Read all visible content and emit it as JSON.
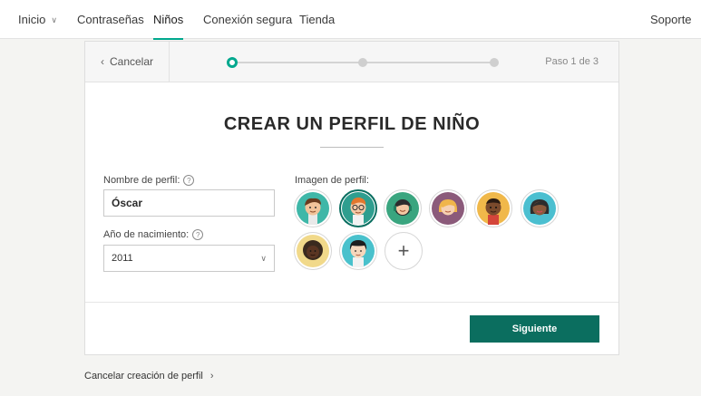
{
  "nav": {
    "items": [
      {
        "label": "Inicio",
        "dropdown": true
      },
      {
        "label": "Contraseñas"
      },
      {
        "label": "Niños",
        "active": true
      },
      {
        "label": "Conexión segura"
      },
      {
        "label": "Tienda"
      }
    ],
    "support": "Soporte"
  },
  "stepper": {
    "cancel": "Cancelar",
    "step_label": "Paso 1 de 3",
    "current_step": 1,
    "total_steps": 3
  },
  "form": {
    "title": "CREAR UN PERFIL DE NIÑO",
    "profile_name_label": "Nombre de perfil:",
    "profile_name_value": "Óscar",
    "birth_year_label": "Año de nacimiento:",
    "birth_year_value": "2011",
    "image_label": "Imagen de perfil:",
    "help_symbol": "?",
    "add_symbol": "+",
    "avatars": [
      {
        "name": "boy-brown-hair",
        "bg": "#3fb7a8",
        "selected": false
      },
      {
        "name": "boy-glasses",
        "bg": "#2f9e8f",
        "selected": true
      },
      {
        "name": "girl-headset",
        "bg": "#3aa57f",
        "selected": false
      },
      {
        "name": "girl-blonde",
        "bg": "#8b5a7a",
        "selected": false
      },
      {
        "name": "boy-dark-skin",
        "bg": "#f0b84a",
        "selected": false
      },
      {
        "name": "girl-dark-hair",
        "bg": "#4bbfd0",
        "selected": false
      },
      {
        "name": "girl-curly-hair",
        "bg": "#f1d98a",
        "selected": false
      },
      {
        "name": "boy-black-hair",
        "bg": "#49c1cc",
        "selected": false
      }
    ]
  },
  "actions": {
    "next": "Siguiente",
    "cancel_profile": "Cancelar creación de perfil"
  },
  "colors": {
    "accent": "#00a88e",
    "button": "#0b6e5f"
  }
}
